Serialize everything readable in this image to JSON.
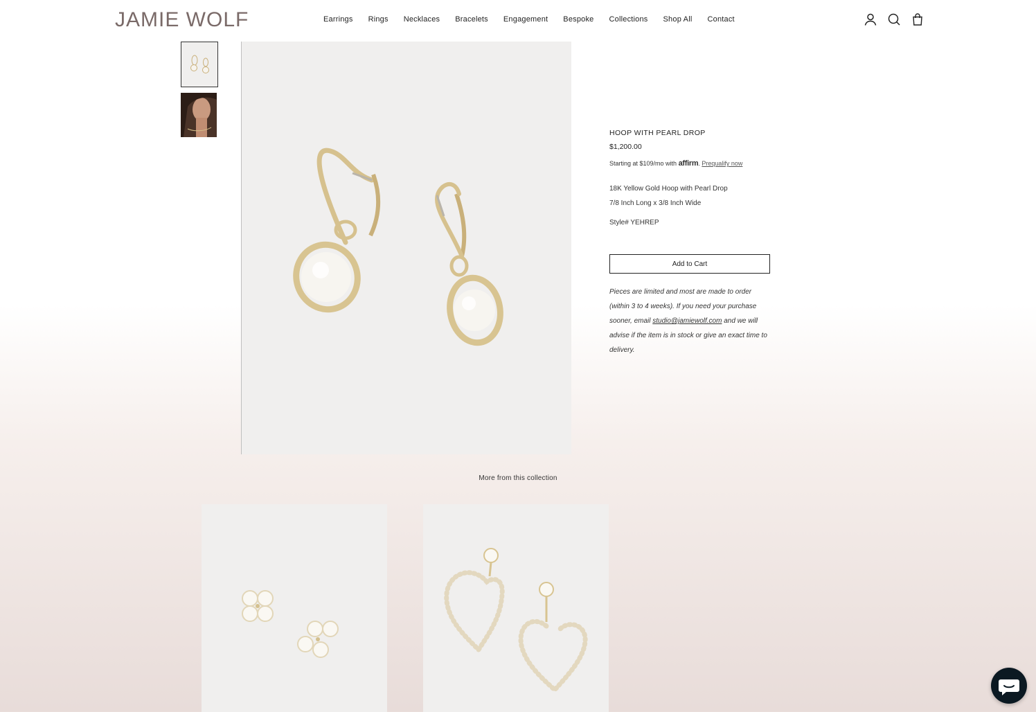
{
  "header": {
    "logo": "JAMIE WOLF",
    "nav": [
      "Earrings",
      "Rings",
      "Necklaces",
      "Bracelets",
      "Engagement",
      "Bespoke",
      "Collections",
      "Shop All",
      "Contact"
    ],
    "icons": [
      "account-icon",
      "search-icon",
      "cart-icon"
    ]
  },
  "product": {
    "title": "HOOP WITH PEARL DROP",
    "price": "$1,200.00",
    "affirm_prefix": "Starting at $109/mo with",
    "affirm_brand": "affirm",
    "affirm_link": "Prequalify now",
    "description_1": "18K Yellow Gold Hoop with Pearl Drop",
    "description_2": "7/8 Inch Long x 3/8 Inch Wide",
    "style": "Style# YEHREP",
    "add_to_cart": "Add to Cart",
    "note_before": "Pieces are limited and most are made to order (within 3 to 4 weeks). If you need your purchase sooner, email ",
    "note_email": "studio@jamiewolf.com",
    "note_after": " and we will advise if the item is in stock or give an exact time to delivery."
  },
  "related": {
    "title": "More from this collection"
  },
  "colors": {
    "accent": "#222222",
    "logo": "#7a6a68",
    "gold": "#c9b07a",
    "chat": "#0b1922"
  }
}
